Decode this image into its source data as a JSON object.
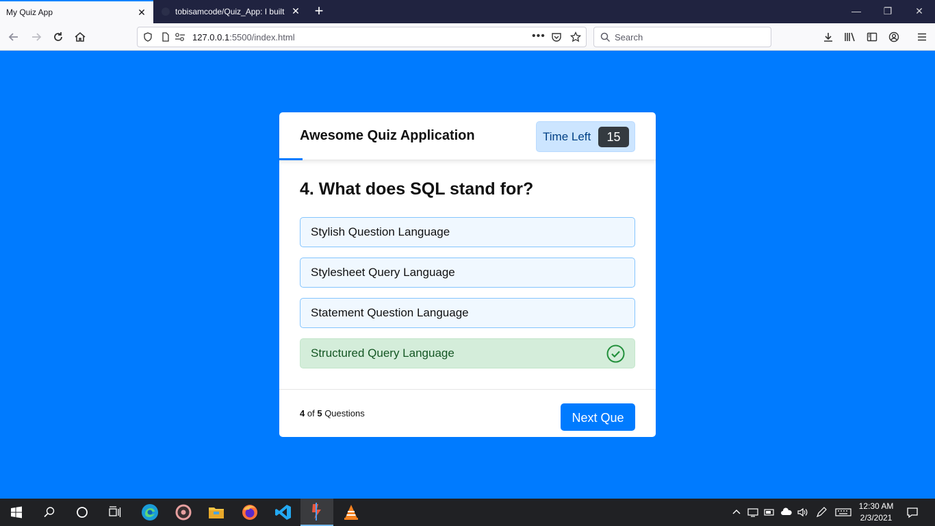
{
  "browser": {
    "tabs": [
      {
        "title": "My Quiz App",
        "active": true
      },
      {
        "title": "tobisamcode/Quiz_App: I built",
        "active": false
      }
    ],
    "url_host": "127.0.0.1",
    "url_rest": ":5500/index.html",
    "search_placeholder": "Search"
  },
  "quiz": {
    "title": "Awesome Quiz Application",
    "timer_label": "Time Left",
    "timer_seconds": "15",
    "question": "4. What does SQL stand for?",
    "options": [
      {
        "text": "Stylish Question Language",
        "state": "default"
      },
      {
        "text": "Stylesheet Query Language",
        "state": "default"
      },
      {
        "text": "Statement Question Language",
        "state": "default"
      },
      {
        "text": "Structured Query Language",
        "state": "correct"
      }
    ],
    "footer": {
      "current": "4",
      "of": "of",
      "total": "5",
      "label": "Questions"
    },
    "next_button": "Next Que"
  },
  "taskbar": {
    "time": "12:30 AM",
    "date": "2/3/2021"
  },
  "colors": {
    "page_background": "#007bff",
    "correct_background": "#d4edda",
    "correct_text": "#155724",
    "timer_background": "#cce5ff"
  }
}
